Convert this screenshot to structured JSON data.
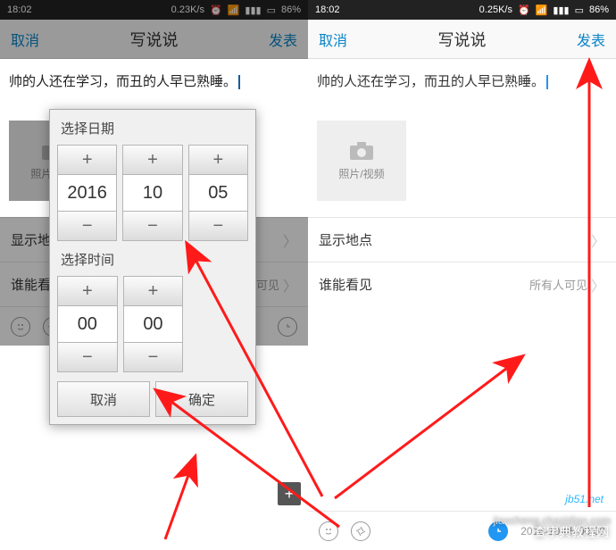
{
  "statusbar": {
    "time": "18:02",
    "speed_left": "0.23K/s",
    "speed_right": "0.25K/s",
    "battery": "86%",
    "alarm_icon": "⏰",
    "wifi_icon": "📶",
    "signal_icon": "▮▮▮",
    "vibrate_icon": "📳",
    "batt_icon": "▭"
  },
  "nav": {
    "cancel": "取消",
    "title": "写说说",
    "publish": "发表"
  },
  "post": {
    "text": "帅的人还在学习，而丑的人早已熟睡。"
  },
  "media": {
    "label": "照片/视频"
  },
  "rows": {
    "location": {
      "label": "显示地点",
      "chev": "〉"
    },
    "visibility": {
      "label": "谁能看见",
      "value": "所有人可见",
      "chev": "〉"
    }
  },
  "modal": {
    "date_title": "选择日期",
    "time_title": "选择时间",
    "year": "2016",
    "month": "10",
    "day": "05",
    "hour": "00",
    "minute": "00",
    "plus": "+",
    "minus": "−",
    "cancel": "取消",
    "ok": "确定"
  },
  "bottom": {
    "timestamp": "2016-10-05 00:00"
  },
  "fab": {
    "plus": "+"
  },
  "watermark": {
    "main": "查字典教程网",
    "sub": "jiaocheng.chazidian.com",
    "jb51": "jb51.net"
  }
}
